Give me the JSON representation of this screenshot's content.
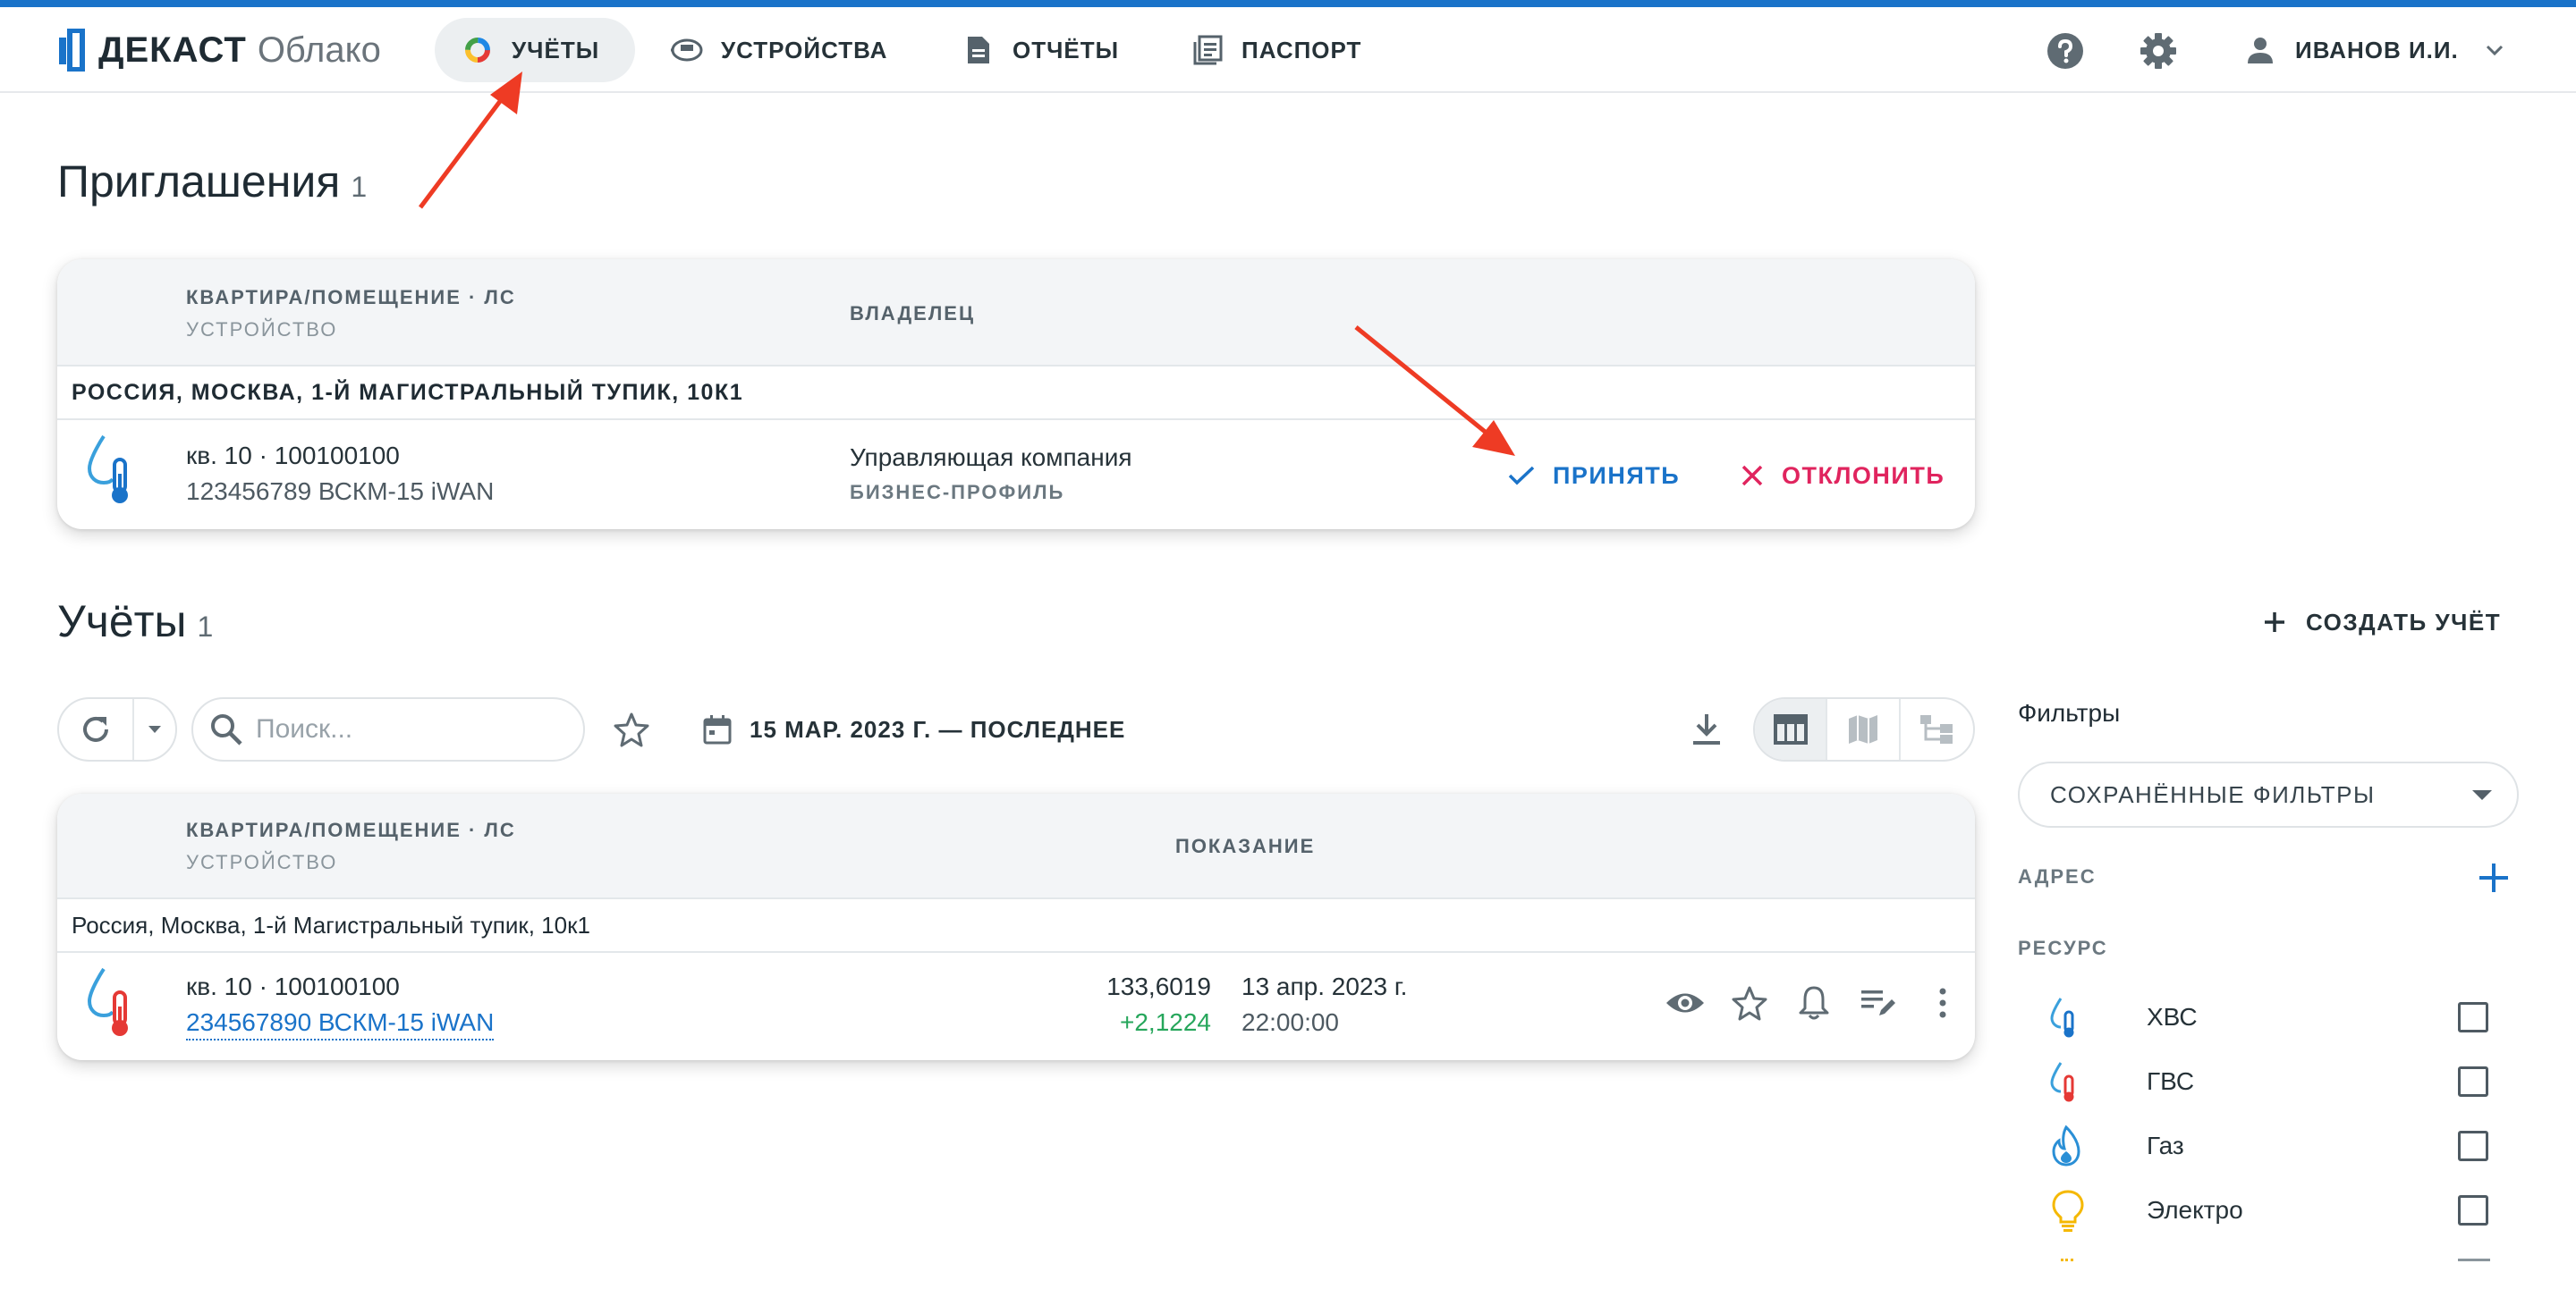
{
  "header": {
    "logo_word": "ДЕКАСТ",
    "logo_sub": "Облако",
    "nav": [
      {
        "label": "УЧЁТЫ",
        "icon": "donut-chart-icon",
        "active": true
      },
      {
        "label": "УСТРОЙСТВА",
        "icon": "device-icon",
        "active": false
      },
      {
        "label": "ОТЧЁТЫ",
        "icon": "document-icon",
        "active": false
      },
      {
        "label": "ПАСПОРТ",
        "icon": "passport-icon",
        "active": false
      }
    ],
    "user_name": "ИВАНОВ И.И."
  },
  "invitations": {
    "title": "Приглашения",
    "count": "1",
    "columns": {
      "apartment": "КВАРТИРА/ПОМЕЩЕНИЕ · ЛС",
      "device": "УСТРОЙСТВО",
      "owner": "ВЛАДЕЛЕЦ"
    },
    "group_address": "РОССИЯ, МОСКВА, 1-Й МАГИСТРАЛЬНЫЙ ТУПИК, 10К1",
    "rows": [
      {
        "apartment": "кв. 10 · 100100100",
        "device": "123456789 ВСКМ-15 iWAN",
        "owner": "Управляющая компания",
        "owner_type": "БИЗНЕС-ПРОФИЛЬ",
        "accept_label": "ПРИНЯТЬ",
        "decline_label": "ОТКЛОНИТЬ"
      }
    ]
  },
  "accounts": {
    "title": "Учёты",
    "count": "1",
    "create_label": "СОЗДАТЬ УЧЁТ",
    "search_placeholder": "Поиск...",
    "date_range": "15 МАР. 2023 Г. — ПОСЛЕДНЕЕ",
    "columns": {
      "apartment": "КВАРТИРА/ПОМЕЩЕНИЕ · ЛС",
      "device": "УСТРОЙСТВО",
      "reading": "ПОКАЗАНИЕ"
    },
    "group_address": "Россия, Москва, 1-й Магистральный тупик, 10к1",
    "rows": [
      {
        "apartment": "кв. 10 · 100100100",
        "device": "234567890 ВСКМ-15 iWAN",
        "reading": "133,6019",
        "delta": "+2,1224",
        "date": "13 апр. 2023 г.",
        "time": "22:00:00"
      }
    ]
  },
  "filters": {
    "title": "Фильтры",
    "saved_label": "СОХРАНЁННЫЕ ФИЛЬТРЫ",
    "address_label": "АДРЕС",
    "resource_label": "РЕСУРС",
    "resources": [
      {
        "label": "ХВС",
        "icon": "cold-water-icon",
        "checked": false
      },
      {
        "label": "ГВС",
        "icon": "hot-water-icon",
        "checked": false
      },
      {
        "label": "Газ",
        "icon": "gas-flame-icon",
        "checked": false
      },
      {
        "label": "Электро",
        "icon": "light-bulb-icon",
        "checked": false
      }
    ]
  },
  "colors": {
    "accent": "#1a73c9",
    "decline": "#e0245e",
    "positive": "#26a65b",
    "annotation_arrow": "#ee3b24"
  }
}
